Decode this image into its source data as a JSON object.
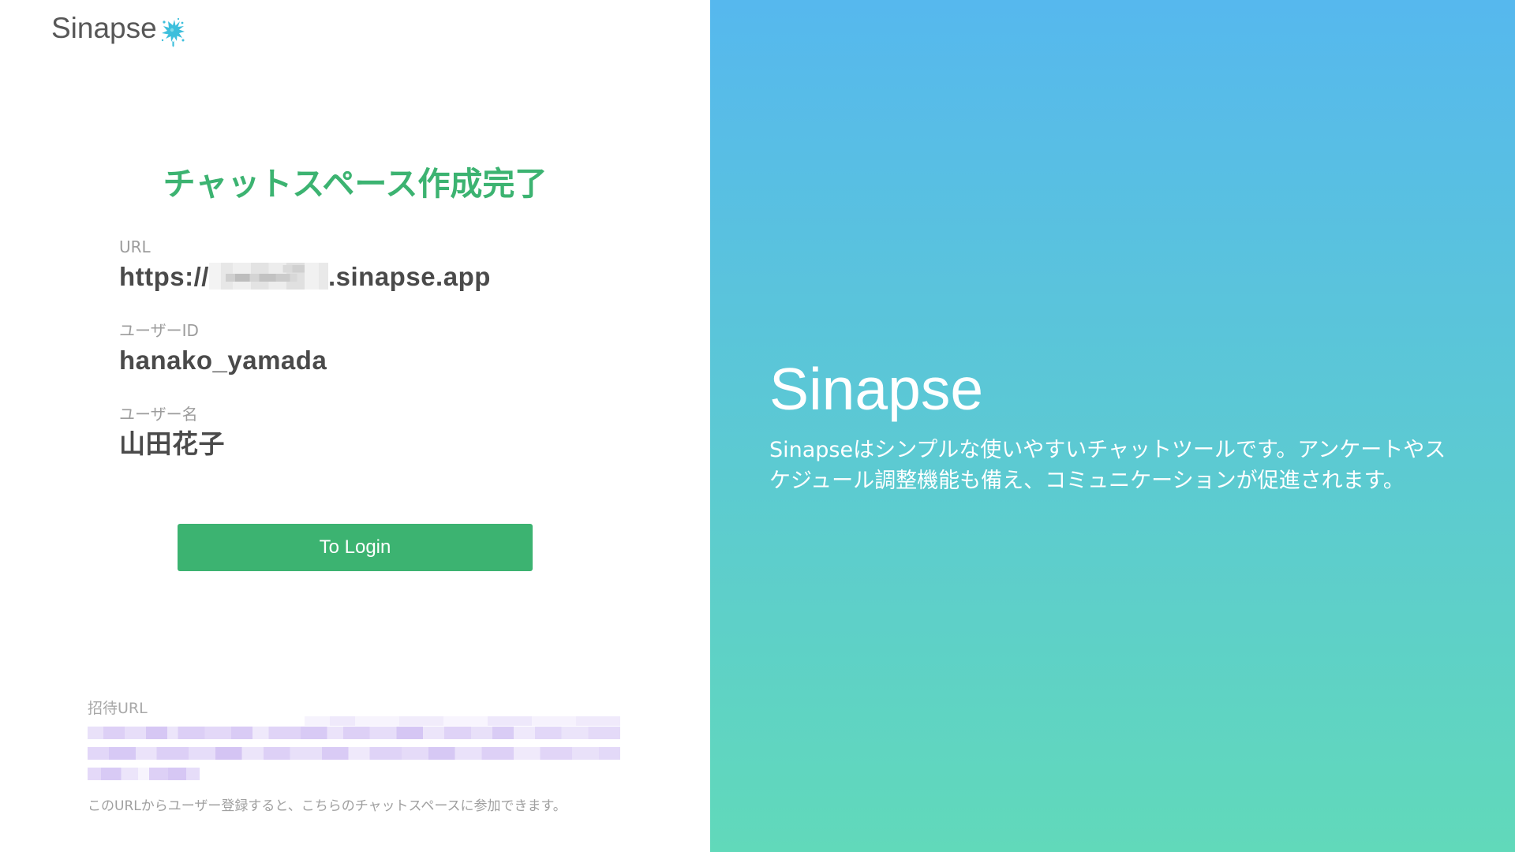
{
  "logo": {
    "text": "Sinapse",
    "icon": "splash-icon"
  },
  "completion": {
    "title": "チャットスペース作成完了",
    "fields": [
      {
        "label": "URL",
        "value_prefix": "https://",
        "value_suffix": ".sinapse.app"
      },
      {
        "label": "ユーザーID",
        "value": "hanako_yamada"
      },
      {
        "label": "ユーザー名",
        "value": "山田花子"
      }
    ],
    "login_button": "To Login"
  },
  "invite": {
    "label": "招待URL",
    "note": "このURLからユーザー登録すると、こちらのチャットスペースに参加できます。"
  },
  "hero": {
    "title": "Sinapse",
    "description": "Sinapseはシンプルな使いやすいチャットツールです。アンケートやスケジュール調整機能も備え、コミュニケーションが促進されます。"
  },
  "colors": {
    "accent": "#3cb371",
    "hero_gradient_top": "#56b8ee",
    "hero_gradient_bottom": "#61d9ba",
    "label_gray": "#9c9c9c",
    "text_dark": "#4a4a4a"
  }
}
